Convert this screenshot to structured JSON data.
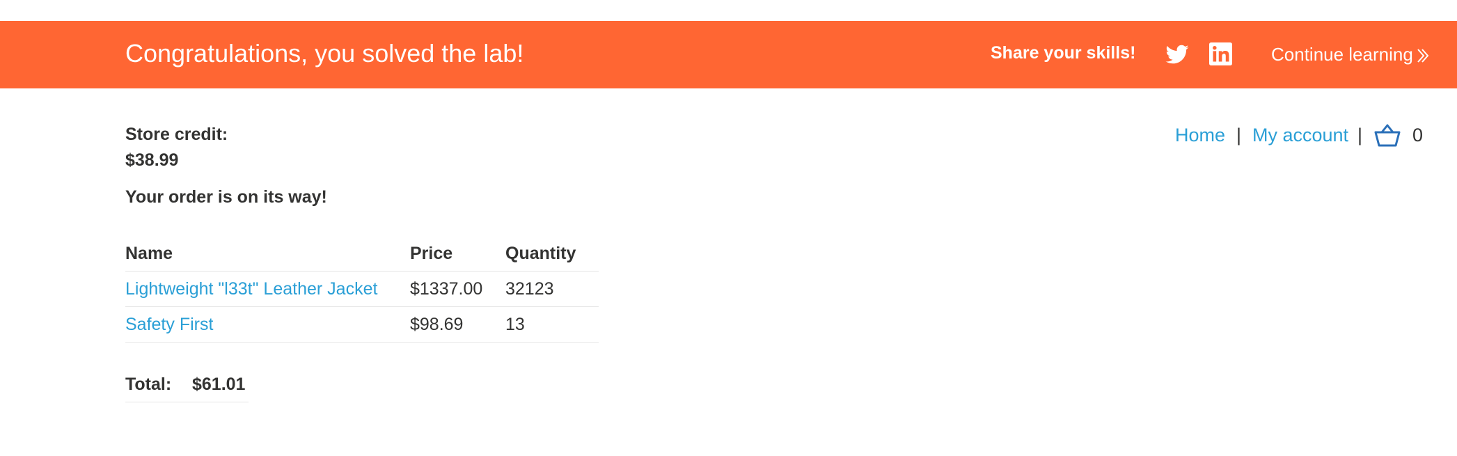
{
  "banner": {
    "title": "Congratulations, you solved the lab!",
    "share_label": "Share your skills!",
    "continue_label": "Continue learning",
    "background_color": "#ff6633",
    "icons": [
      "twitter-icon",
      "linkedin-icon",
      "chevron-double-right-icon"
    ]
  },
  "account": {
    "store_credit_label": "Store credit:",
    "store_credit_value": "$38.99",
    "order_message": "Your order is on its way!"
  },
  "nav": {
    "home_label": "Home",
    "my_account_label": "My account",
    "separator": "|",
    "cart_count": "0",
    "link_color": "#2a9fd6"
  },
  "order_table": {
    "headers": [
      "Name",
      "Price",
      "Quantity"
    ],
    "rows": [
      {
        "name": "Lightweight \"l33t\" Leather Jacket",
        "price": "$1337.00",
        "quantity": "32123"
      },
      {
        "name": "Safety First",
        "price": "$98.69",
        "quantity": "13"
      }
    ]
  },
  "total": {
    "label": "Total:",
    "value": "$61.01"
  }
}
